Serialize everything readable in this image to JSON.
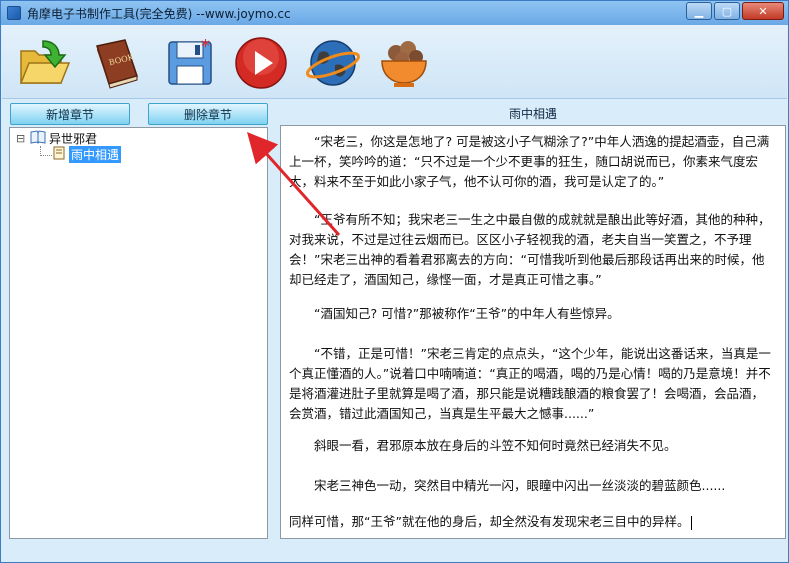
{
  "window": {
    "title": "角摩电子书制作工具(完全免费) --www.joymo.cc",
    "controls": [
      "minimize",
      "maximize",
      "close"
    ],
    "control_glyphs": {
      "minimize": "▁",
      "maximize": "▢",
      "close": "✕"
    }
  },
  "toolbar": {
    "icons": [
      "open-folder-icon",
      "book-icon",
      "save-icon",
      "play-icon",
      "globe-icon",
      "food-bowl-icon"
    ]
  },
  "buttons": {
    "add_chapter": "新增章节",
    "delete_chapter": "删除章节"
  },
  "tree": {
    "root_label": "异世邪君",
    "expand_glyph": "⊟",
    "child_label": "雨中相遇"
  },
  "editor": {
    "chapter_title": "雨中相遇",
    "paragraphs": [
      "“宋老三，你这是怎地了? 可是被这小子气糊涂了?”中年人洒逸的提起酒壶，自己满上一杯，笑吟吟的道：“只不过是一个少不更事的狂生，随口胡说而已，你素来气度宏大，料来不至于如此小家子气，他不认可你的酒，我可是认定了的。”",
      "“王爷有所不知；我宋老三一生之中最自傲的成就就是酿出此等好酒，其他的种种，对我来说，不过是过往云烟而已。区区小子轻视我的酒，老夫自当一笑置之，不予理会！”宋老三出神的看着君邪离去的方向：“可惜我听到他最后那段话再出来的时候，他却已经走了，酒国知己，缘悭一面，才是真正可惜之事。”",
      "“酒国知己? 可惜?”那被称作“王爷”的中年人有些惊异。",
      "“不错，正是可惜！”宋老三肯定的点点头，“这个少年，能说出这番话来，当真是一个真正懂酒的人。”说着口中喃喃道：“真正的喝酒，喝的乃是心情！喝的乃是意境！并不是将酒灌进肚子里就算是喝了酒，那只能是说糟践酿酒的粮食罢了！会喝酒，会品酒，会赏酒，错过此酒国知己，当真是生平最大之憾事......”",
      "斜眼一看，君邪原本放在身后的斗笠不知何时竟然已经消失不见。",
      "宋老三神色一动，突然目中精光一闪，眼瞳中闪出一丝淡淡的碧蓝颜色......",
      "同样可惜，那“王爷”就在他的身后，却全然没有发现宋老三目中的异样。"
    ]
  },
  "colors": {
    "accent_arrow": "#e0262b",
    "titlebar": "#7ab4ec",
    "button_face": "#9fe0f7"
  }
}
